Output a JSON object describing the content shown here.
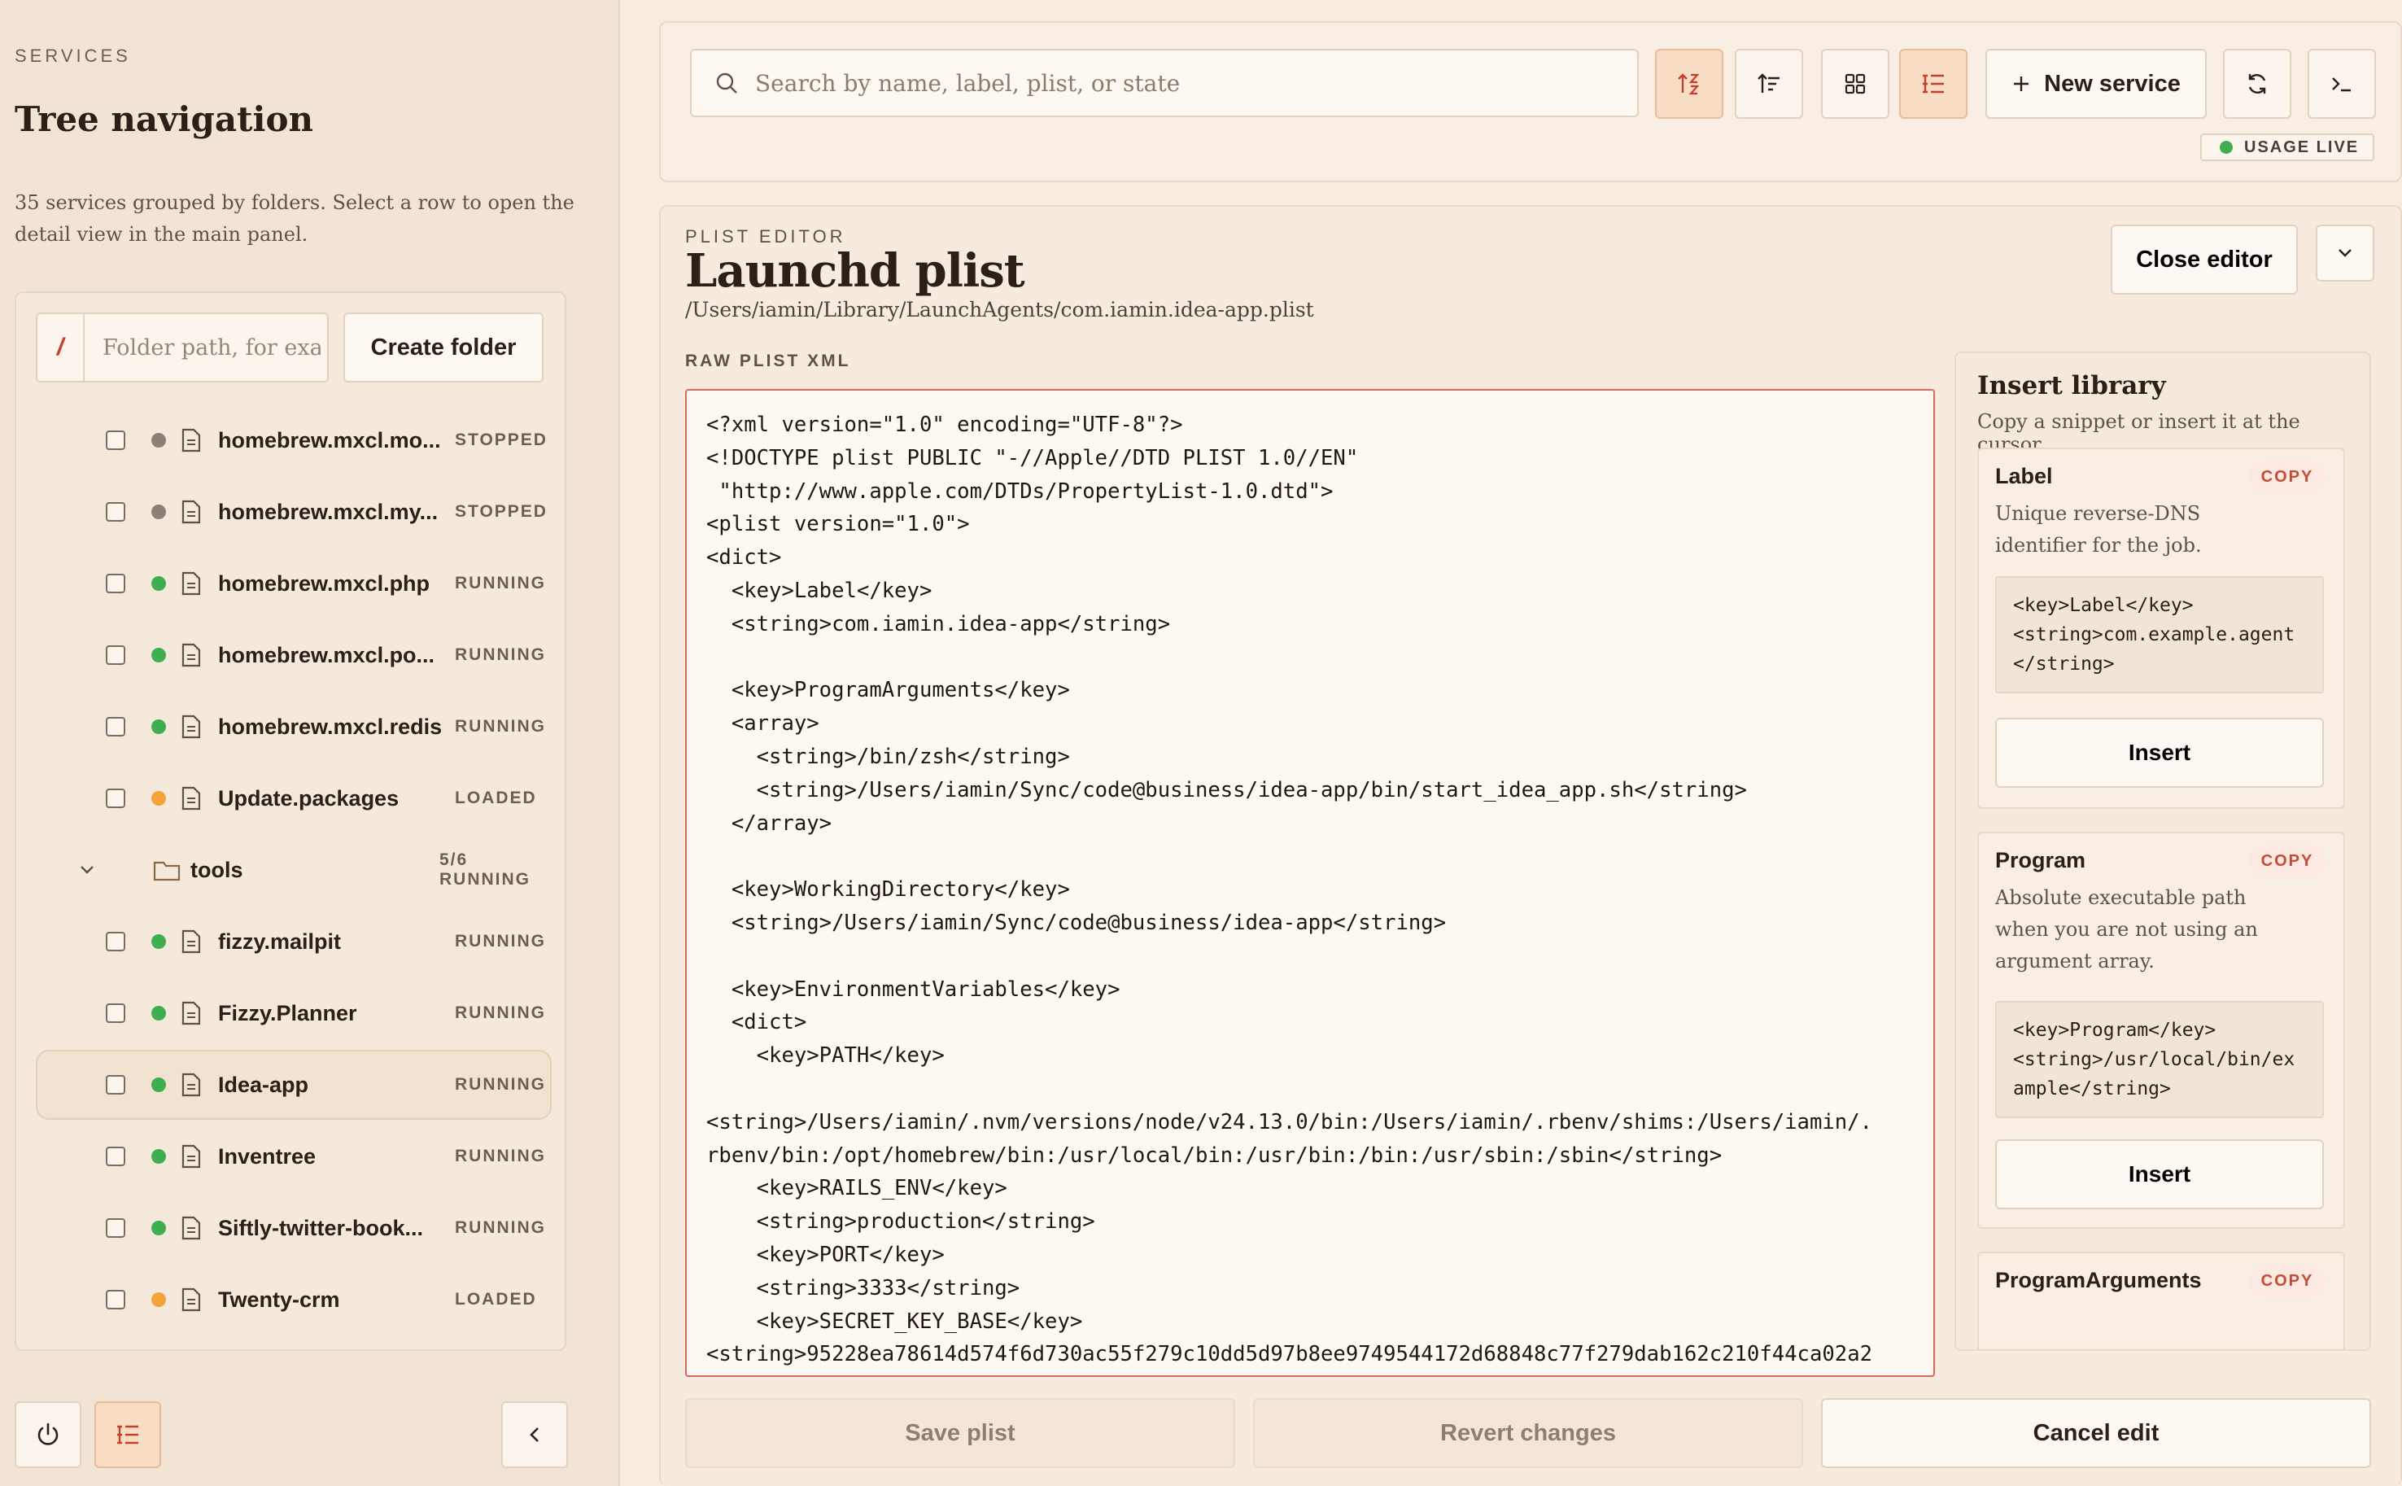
{
  "sidebar": {
    "eyebrow": "SERVICES",
    "title": "Tree navigation",
    "description": "35 services grouped by folders. Select a row to open the detail view in the main panel.",
    "folder_input_placeholder": "Folder path, for exan",
    "folder_prefix": "/",
    "create_folder_label": "Create folder",
    "items": [
      {
        "type": "service",
        "name": "homebrew.mxcl.mo...",
        "state": "STOPPED",
        "status": "stopped"
      },
      {
        "type": "service",
        "name": "homebrew.mxcl.my...",
        "state": "STOPPED",
        "status": "stopped"
      },
      {
        "type": "service",
        "name": "homebrew.mxcl.php",
        "state": "RUNNING",
        "status": "running"
      },
      {
        "type": "service",
        "name": "homebrew.mxcl.po...",
        "state": "RUNNING",
        "status": "running"
      },
      {
        "type": "service",
        "name": "homebrew.mxcl.redis",
        "state": "RUNNING",
        "status": "running"
      },
      {
        "type": "service",
        "name": "Update.packages",
        "state": "LOADED",
        "status": "loaded"
      },
      {
        "type": "folder",
        "name": "tools",
        "count": "5/6 RUNNING"
      },
      {
        "type": "service",
        "name": "fizzy.mailpit",
        "state": "RUNNING",
        "status": "running"
      },
      {
        "type": "service",
        "name": "Fizzy.Planner",
        "state": "RUNNING",
        "status": "running"
      },
      {
        "type": "service",
        "name": "Idea-app",
        "state": "RUNNING",
        "status": "running",
        "selected": true
      },
      {
        "type": "service",
        "name": "Inventree",
        "state": "RUNNING",
        "status": "running"
      },
      {
        "type": "service",
        "name": "Siftly-twitter-book...",
        "state": "RUNNING",
        "status": "running"
      },
      {
        "type": "service",
        "name": "Twenty-crm",
        "state": "LOADED",
        "status": "loaded"
      }
    ]
  },
  "topbar": {
    "search_placeholder": "Search by name, label, plist, or state",
    "new_service_label": "New service",
    "usage_live_label": "USAGE LIVE"
  },
  "editor": {
    "eyebrow": "PLIST EDITOR",
    "title": "Launchd plist",
    "path": "/Users/iamin/Library/LaunchAgents/com.iamin.idea-app.plist",
    "close_label": "Close editor",
    "raw_label": "RAW PLIST XML",
    "xml": "<?xml version=\"1.0\" encoding=\"UTF-8\"?>\n<!DOCTYPE plist PUBLIC \"-//Apple//DTD PLIST 1.0//EN\"\n \"http://www.apple.com/DTDs/PropertyList-1.0.dtd\">\n<plist version=\"1.0\">\n<dict>\n  <key>Label</key>\n  <string>com.iamin.idea-app</string>\n\n  <key>ProgramArguments</key>\n  <array>\n    <string>/bin/zsh</string>\n    <string>/Users/iamin/Sync/code@business/idea-app/bin/start_idea_app.sh</string>\n  </array>\n\n  <key>WorkingDirectory</key>\n  <string>/Users/iamin/Sync/code@business/idea-app</string>\n\n  <key>EnvironmentVariables</key>\n  <dict>\n    <key>PATH</key>\n\n<string>/Users/iamin/.nvm/versions/node/v24.13.0/bin:/Users/iamin/.rbenv/shims:/Users/iamin/.\nrbenv/bin:/opt/homebrew/bin:/usr/local/bin:/usr/bin:/bin:/usr/sbin:/sbin</string>\n    <key>RAILS_ENV</key>\n    <string>production</string>\n    <key>PORT</key>\n    <string>3333</string>\n    <key>SECRET_KEY_BASE</key>\n<string>95228ea78614d574f6d730ac55f279c10dd5d97b8ee9749544172d68848c77f279dab162c210f44ca02a2",
    "library": {
      "title": "Insert library",
      "subtitle": "Copy a snippet or insert it at the cursor.",
      "copy_label": "COPY",
      "insert_label": "Insert",
      "cards": [
        {
          "name": "Label",
          "description": "Unique reverse-DNS identifier for the job.",
          "code": "<key>Label</key>\n<string>com.example.agent\n</string>"
        },
        {
          "name": "Program",
          "description": "Absolute executable path when you are not using an argument array.",
          "code": "<key>Program</key>\n<string>/usr/local/bin/example</string>"
        },
        {
          "name": "ProgramArguments"
        }
      ]
    },
    "save_label": "Save plist",
    "revert_label": "Revert changes",
    "cancel_label": "Cancel edit"
  },
  "colors": {
    "accent": "#c2412c",
    "running": "#3fae4e",
    "stopped": "#8c8178",
    "loaded": "#f3a33a"
  }
}
